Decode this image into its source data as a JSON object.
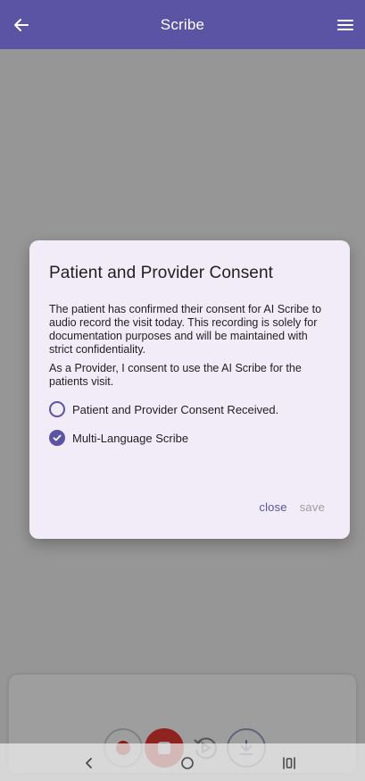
{
  "app_bar": {
    "title": "Scribe",
    "back_icon": "arrow-left-icon",
    "menu_icon": "hamburger-menu-icon",
    "color": "#5b53a3"
  },
  "dialog": {
    "title": "Patient and Provider Consent",
    "paragraph1": "The patient has confirmed their consent for AI Scribe to audio record the visit today. This recording is solely for documentation purposes and will be maintained with strict confidentiality.",
    "paragraph2": "As a Provider, I consent to use the AI Scribe for the patients visit.",
    "options": [
      {
        "label": "Patient and Provider Consent Received.",
        "checked": false
      },
      {
        "label": "Multi-Language Scribe",
        "checked": true
      }
    ],
    "close_label": "close",
    "save_label": "save"
  },
  "controls": {
    "record_icon": "record-icon",
    "stop_icon": "stop-icon",
    "replay_icon": "replay-icon",
    "download_icon": "download-icon"
  },
  "system_nav": {
    "back_icon": "nav-back-icon",
    "home_icon": "nav-home-icon",
    "recents_icon": "nav-recents-icon"
  }
}
